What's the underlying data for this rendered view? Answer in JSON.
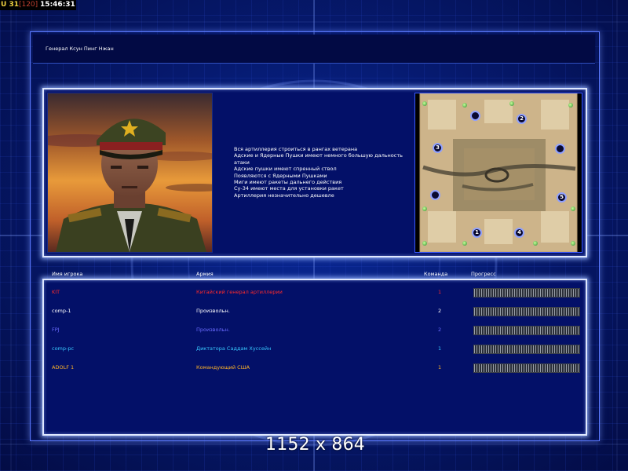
{
  "hud": {
    "units": "U 31",
    "cap": "[120]",
    "time": "15:46:31"
  },
  "title": "Генерал Ксун Пинг Нжан",
  "description": [
    "Вся артиллерия строиться в рангах ветерана",
    "Адские и Ядерные Пушки имеют немного большую дальность",
    "атаки",
    "Адские пушки имеют спренный ствол",
    "Появляются с Ядерными Пушками",
    "Миги имеют ракеты дальнего действия",
    "Су-34 имеют места для установки ракет",
    "Артиллерия незначительно дешевле"
  ],
  "columns": {
    "player": "Имя игрока",
    "army": "Армия",
    "team": "Команда",
    "progress": "Прогресс"
  },
  "players": [
    {
      "name": "KIT",
      "army": "Китайский генерал артиллерии",
      "team": "1",
      "color": "#ff2a2a",
      "progress": 1.0
    },
    {
      "name": "comp-1",
      "army": "Произвольн.",
      "team": "2",
      "color": "#ffffff",
      "progress": 1.0
    },
    {
      "name": "FPJ",
      "army": "Произвольн.",
      "team": "2",
      "color": "#6a6aff",
      "progress": 1.0
    },
    {
      "name": "comp-pc",
      "army": "Диктатора Саддам Хуссейн",
      "team": "1",
      "color": "#38c8ff",
      "progress": 1.0
    },
    {
      "name": "ADOLF 1",
      "army": "Командующий США",
      "team": "1",
      "color": "#ffb428",
      "progress": 1.0
    }
  ],
  "minimap": {
    "markers": [
      {
        "label": "",
        "name": "start-marker-empty-1"
      },
      {
        "label": "2",
        "name": "start-marker-2"
      },
      {
        "label": "3",
        "name": "start-marker-3"
      },
      {
        "label": "",
        "name": "start-marker-empty-2"
      },
      {
        "label": "",
        "name": "start-marker-empty-3"
      },
      {
        "label": "5",
        "name": "start-marker-5"
      },
      {
        "label": "1",
        "name": "start-marker-1"
      },
      {
        "label": "4",
        "name": "start-marker-4"
      }
    ]
  },
  "resolution_text": "1152 x 864"
}
